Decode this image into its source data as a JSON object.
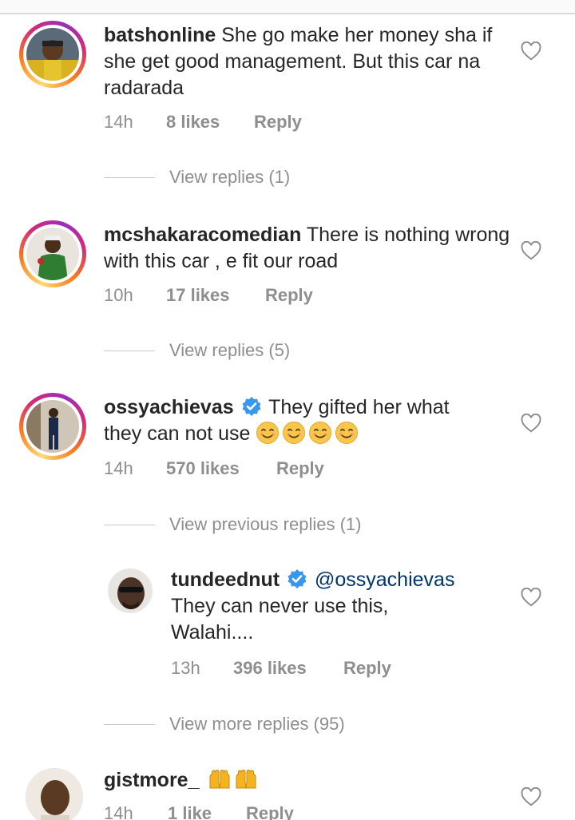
{
  "comments": [
    {
      "username": "batshonline",
      "text": "She go make her money sha if she get good management. But this car na radarada",
      "time": "14h",
      "likes": "8 likes",
      "reply": "Reply",
      "view_replies": "View replies (1)"
    },
    {
      "username": "mcshakaracomedian",
      "text": "There is nothing wrong with this car , e fit our road",
      "time": "10h",
      "likes": "17 likes",
      "reply": "Reply",
      "view_replies": "View replies (5)"
    },
    {
      "username": "ossyachievas",
      "text_line1": "They gifted her what",
      "text_line2": "they can not use",
      "emoji": [
        "😊",
        "😊",
        "😊",
        "😊"
      ],
      "time": "14h",
      "likes": "570 likes",
      "reply": "Reply",
      "view_previous": "View previous replies (1)",
      "reply_thread": {
        "username": "tundeednut",
        "mention": "@ossyachievas",
        "text_line1": "They can never use this,",
        "text_line2": "Walahi....",
        "time": "13h",
        "likes": "396 likes",
        "reply": "Reply"
      },
      "view_more": "View more replies (95)"
    },
    {
      "username": "gistmore_",
      "emoji": [
        "🙌",
        "🙌"
      ],
      "time": "14h",
      "likes": "1 like",
      "reply": "Reply"
    }
  ],
  "colors": {
    "text": "#262626",
    "muted": "#8e8e8e",
    "mention": "#003569",
    "verified": "#3897f0"
  },
  "icons": [
    "heart-outline-icon",
    "verified-badge-icon",
    "smiling-face-icon",
    "raising-hands-icon"
  ]
}
